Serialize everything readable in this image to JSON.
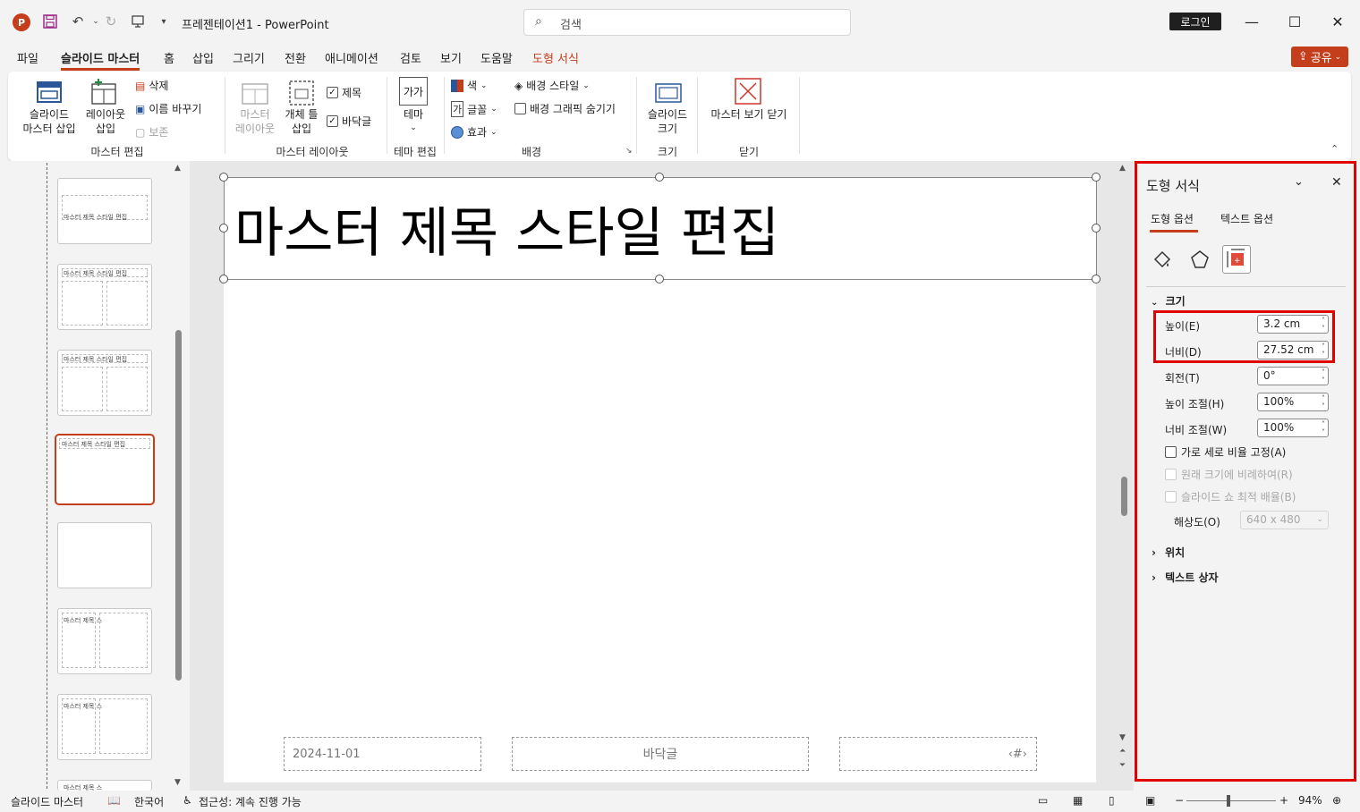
{
  "titlebar": {
    "app_logo": "P",
    "doc_title": "프레젠테이션1  -  PowerPoint",
    "search_placeholder": "검색",
    "login_label": "로그인",
    "share_label": "공유"
  },
  "tabs": [
    {
      "label": "파일"
    },
    {
      "label": "슬라이드 마스터"
    },
    {
      "label": "홈"
    },
    {
      "label": "삽입"
    },
    {
      "label": "그리기"
    },
    {
      "label": "전환"
    },
    {
      "label": "애니메이션"
    },
    {
      "label": "검토"
    },
    {
      "label": "보기"
    },
    {
      "label": "도움말"
    },
    {
      "label": "도형 서식"
    }
  ],
  "ribbon": {
    "master_edit": {
      "insert_master": "슬라이드\n마스터 삽입",
      "insert_layout": "레이아웃\n삽입",
      "delete": "삭제",
      "rename": "이름 바꾸기",
      "preserve": "보존",
      "group": "마스터 편집"
    },
    "master_layout": {
      "master_layout_btn": "마스터\n레이아웃",
      "insert_placeholder": "개체 틀\n삽입",
      "title_cb": "제목",
      "footer_cb": "바닥글",
      "group": "마스터 레이아웃"
    },
    "theme_edit": {
      "theme": "테마",
      "theme_icon": "가가",
      "group": "테마 편집"
    },
    "background": {
      "colors": "색",
      "fonts": "글꼴",
      "effects": "효과",
      "bg_styles": "배경 스타일",
      "hide_bg": "배경 그래픽 숨기기",
      "group": "배경"
    },
    "size": {
      "slide_size": "슬라이드\n크기",
      "group": "크기"
    },
    "close": {
      "close_master": "마스터 보기 닫기",
      "group": "닫기"
    }
  },
  "thumbnails": [
    {
      "title": "마스터 제목 스타일 편집"
    },
    {
      "title": "마스터 제목 스타일 편집"
    },
    {
      "title": "마스터 제목 스타일 편집"
    },
    {
      "title": "마스터 제목 스타일 편집"
    },
    {
      "title": ""
    },
    {
      "title": "마스터 제목 스"
    },
    {
      "title": "마스터 제목 스"
    },
    {
      "title": "마스터 제목 스"
    }
  ],
  "slide": {
    "title": "마스터 제목 스타일 편집",
    "date": "2024-11-01",
    "footer": "바닥글",
    "page_num": "‹#›"
  },
  "format_pane": {
    "title": "도형 서식",
    "tab_shape": "도형 옵션",
    "tab_text": "텍스트 옵션",
    "section_size": "크기",
    "height_label": "높이(E)",
    "height_value": "3.2 cm",
    "width_label": "너비(D)",
    "width_value": "27.52 cm",
    "rotation_label": "회전(T)",
    "rotation_value": "0°",
    "scale_h_label": "높이 조절(H)",
    "scale_h_value": "100%",
    "scale_w_label": "너비 조절(W)",
    "scale_w_value": "100%",
    "lock_aspect": "가로 세로 비율 고정(A)",
    "relative_original": "원래 크기에 비례하여(R)",
    "best_scale": "슬라이드 쇼 최적 배율(B)",
    "resolution_label": "해상도(O)",
    "resolution_value": "640 x 480",
    "section_position": "위치",
    "section_textbox": "텍스트 상자"
  },
  "statusbar": {
    "view": "슬라이드 마스터",
    "language": "한국어",
    "accessibility": "접근성: 계속 진행 가능",
    "zoom": "94%"
  },
  "colors": {
    "accent": "#c43e1c",
    "highlight": "#e00000"
  }
}
